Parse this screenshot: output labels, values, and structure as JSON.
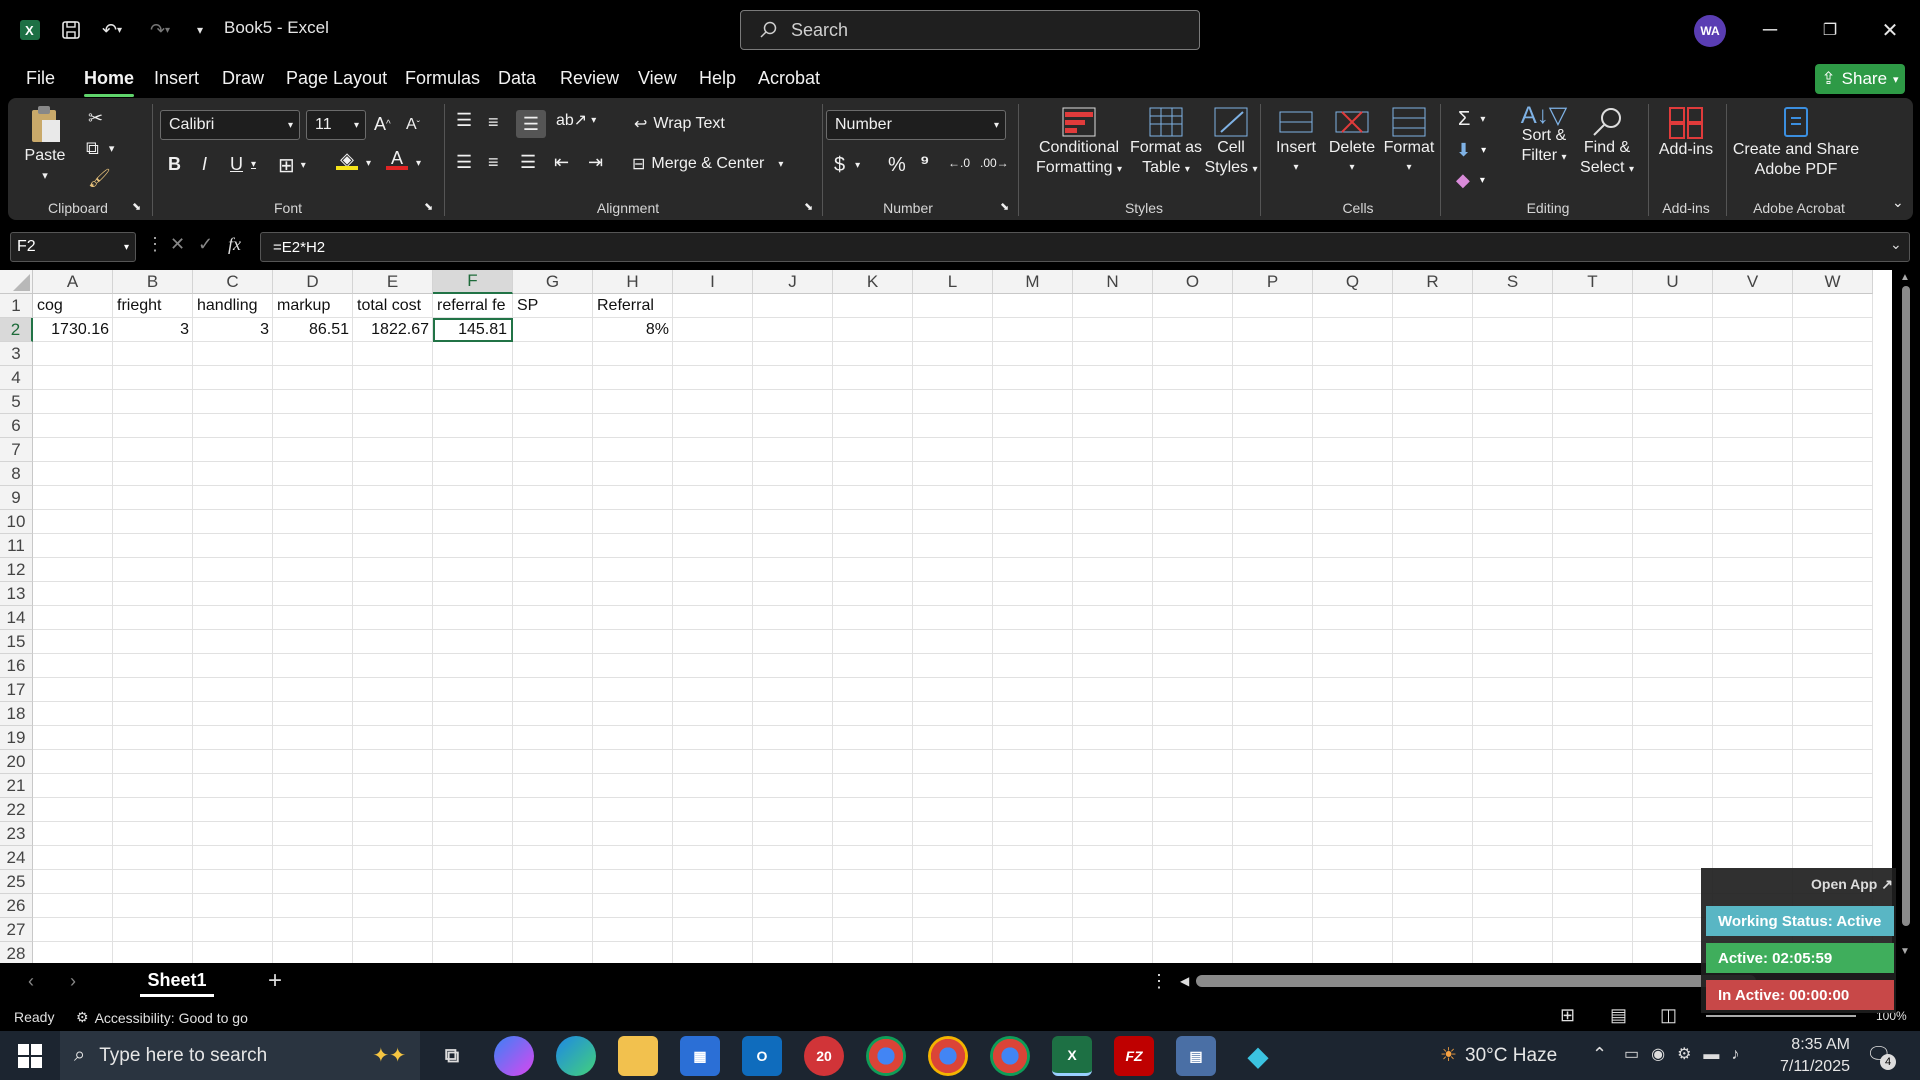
{
  "app": {
    "title": "Book5  -  Excel",
    "search_placeholder": "Search",
    "avatar": "WA"
  },
  "menu": [
    "File",
    "Home",
    "Insert",
    "Draw",
    "Page Layout",
    "Formulas",
    "Data",
    "Review",
    "View",
    "Help",
    "Acrobat"
  ],
  "share_label": "Share",
  "ribbon": {
    "clipboard": {
      "paste": "Paste",
      "label": "Clipboard"
    },
    "font": {
      "family": "Calibri",
      "size": "11",
      "label": "Font"
    },
    "alignment": {
      "wrap": "Wrap Text",
      "merge": "Merge & Center",
      "label": "Alignment"
    },
    "number": {
      "format": "Number",
      "label": "Number"
    },
    "styles": {
      "conditional": [
        "Conditional",
        "Formatting"
      ],
      "format_table": [
        "Format as",
        "Table"
      ],
      "cell_styles": [
        "Cell",
        "Styles"
      ],
      "label": "Styles"
    },
    "cells": {
      "insert": "Insert",
      "delete": "Delete",
      "format": "Format",
      "label": "Cells"
    },
    "editing": {
      "sort": [
        "Sort &",
        "Filter"
      ],
      "find": [
        "Find &",
        "Select"
      ],
      "label": "Editing"
    },
    "addins": {
      "btn": "Add-ins",
      "label": "Add-ins"
    },
    "acrobat": {
      "btn": [
        "Create and Share",
        "Adobe PDF"
      ],
      "label": "Adobe Acrobat"
    }
  },
  "formula_bar": {
    "name_box": "F2",
    "formula": "=E2*H2"
  },
  "columns": [
    "A",
    "B",
    "C",
    "D",
    "E",
    "F",
    "G",
    "H",
    "I",
    "J",
    "K",
    "L",
    "M",
    "N",
    "O",
    "P",
    "Q",
    "R",
    "S",
    "T",
    "U",
    "V",
    "W"
  ],
  "rows": [
    "1",
    "2",
    "3",
    "4",
    "5",
    "6",
    "7",
    "8",
    "9",
    "10",
    "11",
    "12",
    "13",
    "14",
    "15",
    "16",
    "17",
    "18",
    "19",
    "20",
    "21",
    "22",
    "23",
    "24",
    "25",
    "26",
    "27",
    "28"
  ],
  "cells": {
    "A1": "cog",
    "B1": "frieght",
    "C1": "handling",
    "D1": "markup",
    "E1": "total cost",
    "F1": "referral fe",
    "G1": "SP",
    "H1": "Referral",
    "A2": "1730.16",
    "B2": "3",
    "C2": "3",
    "D2": "86.51",
    "E2": "1822.67",
    "F2": "145.81",
    "H2": "8%"
  },
  "sheet_tab": "Sheet1",
  "status": {
    "ready": "Ready",
    "accessibility": "Accessibility: Good to go",
    "zoom": "100%"
  },
  "widget": {
    "open_app": "Open App ↗",
    "working": "Working Status: Active",
    "active": "Active: 02:05:59",
    "inactive": "In Active: 00:00:00"
  },
  "taskbar": {
    "search": "Type here to search",
    "weather": "30°C  Haze",
    "time": "8:35 AM",
    "date": "7/11/2025",
    "notif_count": "4"
  }
}
